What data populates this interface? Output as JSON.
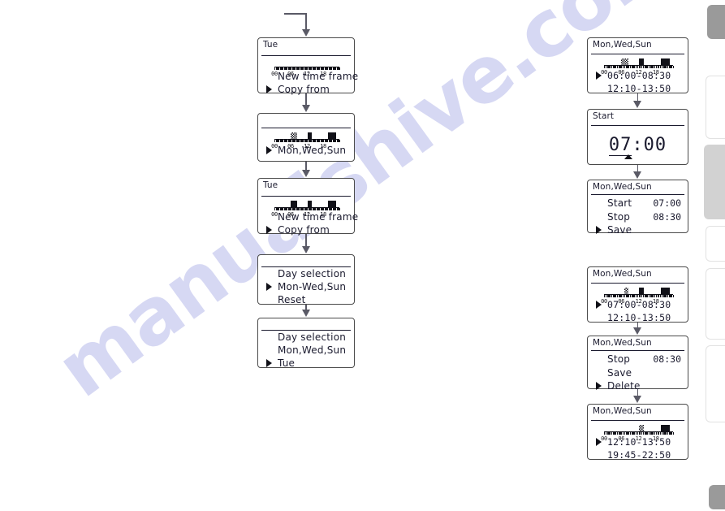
{
  "page": {
    "watermark": "manualshive.com",
    "background": "#ffffff",
    "ink": "#1a1a2e",
    "connector_color": "#5a5a66"
  },
  "timeline": {
    "tick_labels": [
      "00",
      "06",
      "12",
      "18"
    ],
    "cursor_glyph": "▶"
  },
  "edge_tabs": [
    {
      "name": "tab-1",
      "tone": "dark"
    },
    {
      "name": "tab-2",
      "tone": "light"
    },
    {
      "name": "tab-3",
      "tone": "mid"
    },
    {
      "name": "tab-4",
      "tone": "light"
    },
    {
      "name": "tab-5",
      "tone": "light"
    },
    {
      "name": "tab-6",
      "tone": "light"
    },
    {
      "name": "tab-7",
      "tone": "dark"
    }
  ],
  "screens": {
    "left": [
      {
        "id": "left-1",
        "title": "Tue",
        "has_timeline": true,
        "blocks": [],
        "rows": [
          {
            "text": "New time frame",
            "cursor": false
          },
          {
            "text": "Copy from",
            "cursor": true
          }
        ]
      },
      {
        "id": "left-2",
        "title": "",
        "has_timeline": true,
        "blocks": [
          {
            "start": 6.0,
            "end": 8.5,
            "style": "hatch"
          },
          {
            "start": 12.17,
            "end": 13.83,
            "style": "solid"
          },
          {
            "start": 19.75,
            "end": 22.83,
            "style": "solid"
          }
        ],
        "rows": [
          {
            "text": "Mon,Wed,Sun",
            "cursor": true
          }
        ]
      },
      {
        "id": "left-3",
        "title": "Tue",
        "has_timeline": true,
        "blocks": [
          {
            "start": 6.0,
            "end": 8.5,
            "style": "solid"
          },
          {
            "start": 12.17,
            "end": 13.83,
            "style": "solid"
          },
          {
            "start": 19.75,
            "end": 22.83,
            "style": "solid"
          }
        ],
        "rows": [
          {
            "text": "New time frame",
            "cursor": false
          },
          {
            "text": "Copy from",
            "cursor": true
          }
        ]
      },
      {
        "id": "left-4",
        "title": "",
        "has_timeline": false,
        "blocks": [],
        "rows": [
          {
            "text": "Day selection",
            "cursor": false
          },
          {
            "text": "Mon-Wed,Sun",
            "cursor": true
          },
          {
            "text": "Reset",
            "cursor": false
          }
        ]
      },
      {
        "id": "left-5",
        "title": "",
        "has_timeline": false,
        "blocks": [],
        "rows": [
          {
            "text": "Day selection",
            "cursor": false
          },
          {
            "text": "Mon,Wed,Sun",
            "cursor": false
          },
          {
            "text": "Tue",
            "cursor": true
          }
        ]
      }
    ],
    "right": [
      {
        "id": "right-1",
        "title": "Mon,Wed,Sun",
        "has_timeline": true,
        "blocks": [
          {
            "start": 6.0,
            "end": 8.5,
            "style": "hatch"
          },
          {
            "start": 12.17,
            "end": 13.83,
            "style": "solid"
          },
          {
            "start": 19.75,
            "end": 22.83,
            "style": "solid"
          }
        ],
        "rows": [
          {
            "text": "06:00-08:30",
            "cursor": true,
            "mono": true
          },
          {
            "text": "12:10-13:50",
            "cursor": false,
            "mono": true
          }
        ]
      },
      {
        "id": "right-2",
        "title": "Start",
        "has_timeline": false,
        "big_time": {
          "selected": "07",
          "rest": ":00"
        },
        "blocks": [],
        "rows": []
      },
      {
        "id": "right-3",
        "title": "Mon,Wed,Sun",
        "has_timeline": false,
        "blocks": [],
        "rows": [
          {
            "text": "Start",
            "value": "07:00",
            "cursor": false
          },
          {
            "text": "Stop",
            "value": "08:30",
            "cursor": false
          },
          {
            "text": "Save",
            "value": "",
            "cursor": true
          }
        ]
      },
      {
        "id": "right-4",
        "title": "Mon,Wed,Sun",
        "has_timeline": true,
        "blocks": [
          {
            "start": 7.0,
            "end": 8.5,
            "style": "hatch"
          },
          {
            "start": 12.17,
            "end": 13.83,
            "style": "solid"
          },
          {
            "start": 19.75,
            "end": 22.83,
            "style": "solid"
          }
        ],
        "rows": [
          {
            "text": "07:00-08:30",
            "cursor": true,
            "mono": true
          },
          {
            "text": "12:10-13:50",
            "cursor": false,
            "mono": true
          }
        ]
      },
      {
        "id": "right-5",
        "title": "Mon,Wed,Sun",
        "has_timeline": false,
        "blocks": [],
        "rows": [
          {
            "text": "Stop",
            "value": "08:30",
            "cursor": false
          },
          {
            "text": "Save",
            "value": "",
            "cursor": false
          },
          {
            "text": "Delete",
            "value": "",
            "cursor": true
          }
        ]
      },
      {
        "id": "right-6",
        "title": "Mon,Wed,Sun",
        "has_timeline": true,
        "blocks": [
          {
            "start": 12.17,
            "end": 13.83,
            "style": "hatch"
          },
          {
            "start": 19.75,
            "end": 22.83,
            "style": "solid"
          }
        ],
        "rows": [
          {
            "text": "12:10-13:50",
            "cursor": true,
            "mono": true
          },
          {
            "text": "19:45-22:50",
            "cursor": false,
            "mono": true
          }
        ]
      }
    ]
  }
}
